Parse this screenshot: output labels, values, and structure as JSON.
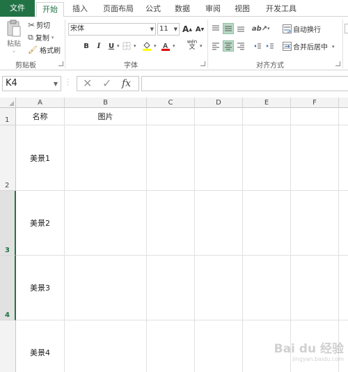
{
  "tabs": [
    {
      "label": "文件"
    },
    {
      "label": "开始"
    },
    {
      "label": "插入"
    },
    {
      "label": "页面布局"
    },
    {
      "label": "公式"
    },
    {
      "label": "数据"
    },
    {
      "label": "审阅"
    },
    {
      "label": "视图"
    },
    {
      "label": "开发工具"
    }
  ],
  "ribbon": {
    "clipboard": {
      "paste": "粘贴",
      "cut": "剪切",
      "copy": "复制",
      "format_painter": "格式刷",
      "group": "剪贴板"
    },
    "font": {
      "name": "宋体",
      "size": "11",
      "bold": "B",
      "italic": "I",
      "underline": "U",
      "grow": "A",
      "shrink": "A",
      "phonetic": "wén",
      "group": "字体"
    },
    "alignment": {
      "wrap": "自动换行",
      "merge": "合并后居中",
      "group": "对齐方式"
    }
  },
  "formula_bar": {
    "name_box": "K4",
    "cancel_icon": "✕",
    "enter_icon": "✓",
    "fx": "fx",
    "value": ""
  },
  "columns": [
    "A",
    "B",
    "C",
    "D",
    "E",
    "F"
  ],
  "rows": [
    {
      "num": "1",
      "a": "名称",
      "b": "图片"
    },
    {
      "num": "2",
      "a": "美景1",
      "b": ""
    },
    {
      "num": "3",
      "a": "美景2",
      "b": ""
    },
    {
      "num": "4",
      "a": "美景3",
      "b": ""
    },
    {
      "num": "",
      "a": "美景4",
      "b": ""
    }
  ],
  "accent": "#217346",
  "watermark": {
    "brand": "Bai du 经验",
    "sub": "jingyan.baidu.com"
  }
}
